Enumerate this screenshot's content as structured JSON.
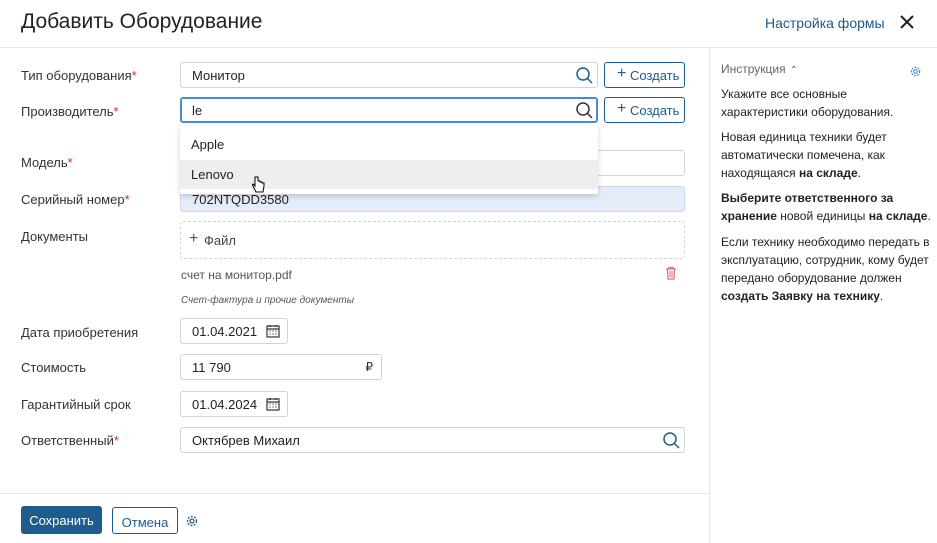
{
  "header": {
    "title": "Добавить Оборудование",
    "form_settings": "Настройка формы"
  },
  "fields": {
    "equipment_type": {
      "label": "Тип оборудования",
      "value": "Монитор",
      "create": "Создать"
    },
    "manufacturer": {
      "label": "Производитель",
      "value": "le",
      "create": "Создать",
      "options": [
        "Apple",
        "Lenovo"
      ]
    },
    "model": {
      "label": "Модель"
    },
    "serial": {
      "label": "Серийный номер",
      "value": "702NTQDD3580"
    },
    "documents": {
      "label": "Документы",
      "add": "Файл",
      "file": "счет на монитор.pdf",
      "hint": "Счет-фактура и прочие документы"
    },
    "purchase_date": {
      "label": "Дата приобретения",
      "value": "01.04.2021"
    },
    "cost": {
      "label": "Стоимость",
      "value": "11 790",
      "currency": "₽"
    },
    "warranty": {
      "label": "Гарантийный срок",
      "value": "01.04.2024"
    },
    "responsible": {
      "label": "Ответственный",
      "value": "Октябрев Михаил"
    }
  },
  "required_mark": "*",
  "footer": {
    "save": "Сохранить",
    "cancel": "Отмена"
  },
  "sidebar": {
    "title": "Инструкция",
    "p1": "Укажите все основные характеристики оборудования.",
    "p2_a": "Новая единица техники будет автоматически помечена, как находящаяся ",
    "p2_b": "на складе",
    "p2_c": ".",
    "p3_a": "Выберите ответственного за хранение",
    "p3_b": " новой единицы ",
    "p3_c": "на складе",
    "p3_d": ".",
    "p4_a": "Если технику необходимо передать в эксплуатацию, сотрудник, кому будет передано оборудование должен ",
    "p4_b": "создать Заявку на технику",
    "p4_c": "."
  },
  "colors": {
    "accent": "#1f5c8e",
    "required": "#d0263a",
    "filled_bg": "#e3ecf8"
  }
}
